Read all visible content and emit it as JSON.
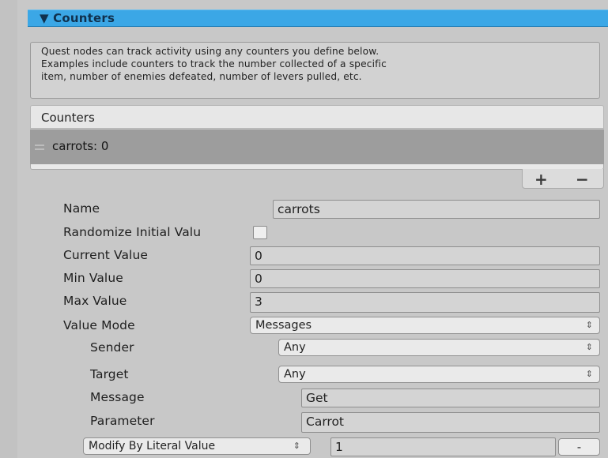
{
  "header": {
    "title": "▼ Counters"
  },
  "info": {
    "lines": [
      "Quest nodes can track activity using any counters you define below.",
      "Examples include counters to track the number collected of a specific",
      "item, number of enemies defeated, number of levers pulled, etc."
    ]
  },
  "list": {
    "header": "Counters",
    "items": [
      {
        "label": "carrots: 0"
      }
    ],
    "add_label": "+",
    "remove_label": "−"
  },
  "fields": {
    "name": {
      "label": "Name",
      "value": "carrots"
    },
    "randomize": {
      "label": "Randomize Initial Valu",
      "checked": false
    },
    "current_value": {
      "label": "Current Value",
      "value": "0"
    },
    "min_value": {
      "label": "Min Value",
      "value": "0"
    },
    "max_value": {
      "label": "Max Value",
      "value": "3"
    },
    "value_mode": {
      "label": "Value Mode",
      "value": "Messages"
    },
    "sender": {
      "label": "Sender",
      "value": "Any"
    },
    "target": {
      "label": "Target",
      "value": "Any"
    },
    "message": {
      "label": "Message",
      "value": "Get"
    },
    "parameter": {
      "label": "Parameter",
      "value": "Carrot"
    },
    "modify": {
      "value": "Modify By Literal Value",
      "amount": "1",
      "button_label": "-"
    }
  },
  "icons": {
    "popup_arrows": "⇕",
    "drag_handle": "drag-handle-icon"
  },
  "colors": {
    "header": "#3ba7e6",
    "selected_row": "#9d9d9d",
    "panel": "#c8c8c8"
  }
}
